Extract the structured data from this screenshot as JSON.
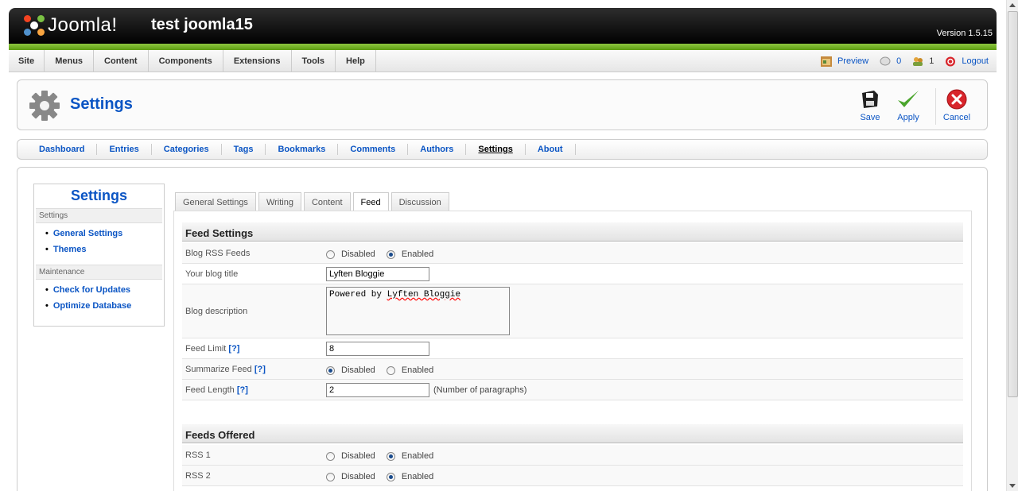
{
  "header": {
    "brand": "Joomla!",
    "site_name": "test joomla15",
    "version": "Version 1.5.15"
  },
  "menu": [
    "Site",
    "Menus",
    "Content",
    "Components",
    "Extensions",
    "Tools",
    "Help"
  ],
  "status": {
    "preview": "Preview",
    "messages": "0",
    "users": "1",
    "logout": "Logout"
  },
  "toolbar": {
    "title": "Settings",
    "save": "Save",
    "apply": "Apply",
    "cancel": "Cancel"
  },
  "submenu": [
    "Dashboard",
    "Entries",
    "Categories",
    "Tags",
    "Bookmarks",
    "Comments",
    "Authors",
    "Settings",
    "About"
  ],
  "sidebar": {
    "title": "Settings",
    "section1": "Settings",
    "items1": [
      "General Settings",
      "Themes"
    ],
    "section2": "Maintenance",
    "items2": [
      "Check for Updates",
      "Optimize Database"
    ]
  },
  "tabs": [
    "General Settings",
    "Writing",
    "Content",
    "Feed",
    "Discussion"
  ],
  "feed": {
    "section_title": "Feed Settings",
    "rss_label": "Blog RSS Feeds",
    "disabled": "Disabled",
    "enabled": "Enabled",
    "title_label": "Your blog title",
    "title_value": "Lyften Bloggie",
    "desc_label": "Blog description",
    "desc_prefix": "Powered by ",
    "desc_value": "Lyften Bloggie",
    "limit_label": "Feed Limit",
    "help": "[?]",
    "limit_value": "8",
    "summarize_label": "Summarize Feed",
    "length_label": "Feed Length",
    "length_value": "2",
    "length_note": "(Number of paragraphs)"
  },
  "offered": {
    "section_title": "Feeds Offered",
    "rss1": "RSS 1",
    "rss2": "RSS 2"
  }
}
